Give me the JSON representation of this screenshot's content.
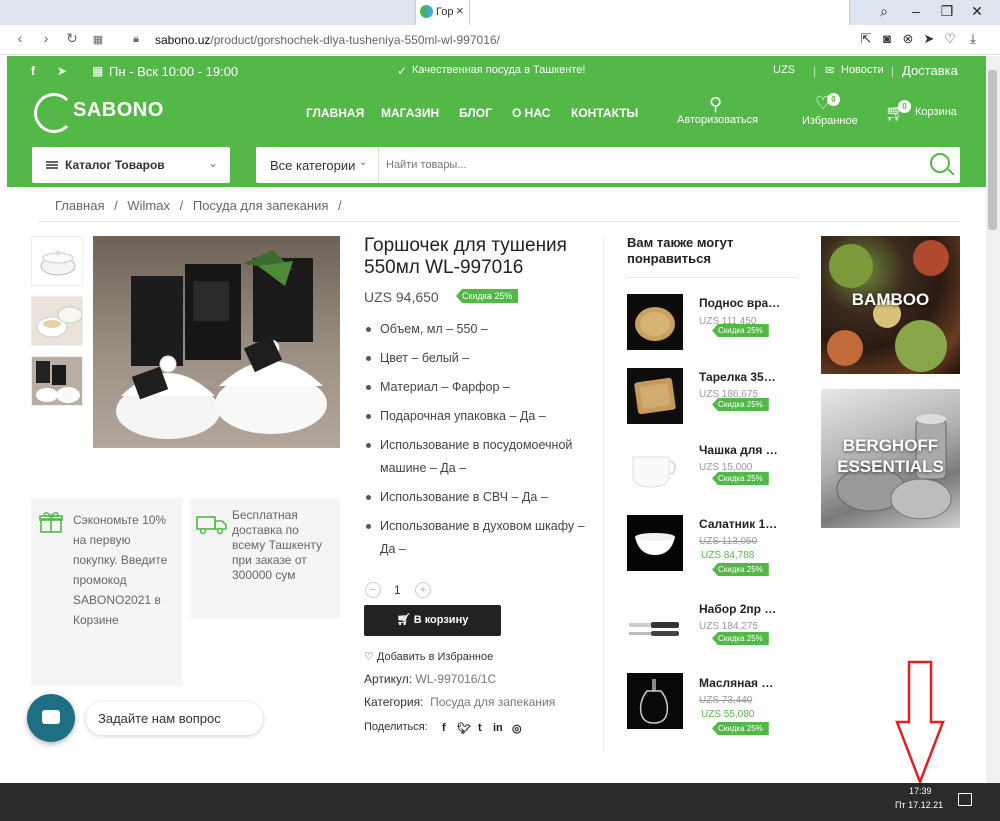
{
  "browser": {
    "tab_title": "Гор",
    "tab_close": "×",
    "url_host": "sabono.uz",
    "url_path": "/product/gorshochek-dlya-tusheniya-550ml-wl-997016/"
  },
  "topstrip": {
    "hours": "Пн - Вск 10:00 - 19:00",
    "slogan": "Качественная посуда в Ташкенте!",
    "currency": "UZS",
    "news": "Новости",
    "delivery": "Доставка"
  },
  "header": {
    "logo": "SABONO",
    "nav": [
      "ГЛАВНАЯ",
      "МАГАЗИН",
      "БЛОГ",
      "О НАС",
      "КОНТАКТЫ"
    ],
    "login": "Авторизоваться",
    "wishlist": "Избранное",
    "wishlist_count": "0",
    "cart": "Корзина",
    "cart_count": "0"
  },
  "search": {
    "catalog_label": "Каталог Товаров",
    "category": "Все категории",
    "placeholder": "Найти товары..."
  },
  "breadcrumb": [
    "Главная",
    "/",
    "Wilmax",
    "/",
    "Посуда для запекания",
    "/"
  ],
  "product": {
    "title": "Горшочек для тушения 550мл WL-997016",
    "price": "UZS 94,650",
    "discount": "Скидка 25%",
    "specs": [
      "Объем, мл – 550 –",
      "Цвет – белый –",
      "Материал – Фарфор –",
      "Подарочная упаковка – Да –",
      "Использование в посудомоечной машине – Да –",
      "Использование в СВЧ – Да –",
      "Использование в духовом шкафу – Да –"
    ],
    "qty_minus": "−",
    "qty": "1",
    "qty_plus": "+",
    "add_to_cart": "В корзину",
    "add_to_wishlist": "Добавить в Избранное",
    "sku_label": "Артикул:",
    "sku": "WL-997016/1C",
    "category_label": "Категория:",
    "category": "Посуда для запекания",
    "share_label": "Поделиться:",
    "share_icons": [
      "f",
      "t-bird",
      "t",
      "in",
      "whatsapp"
    ]
  },
  "info_boxes": {
    "gift": "Сэкономьте 10% на первую покупку. Введите промокод SABONO2021 в Корзине",
    "delivery": "Бесплатная доставка по всему Ташкенту при заказе от 300000 сум"
  },
  "recommended": {
    "title": "Вам также могут понравиться",
    "items": [
      {
        "name": "Поднос вра…",
        "old": "",
        "price": "UZS 111,450",
        "discount": "Скидка 25%"
      },
      {
        "name": "Тарелка 35…",
        "old": "",
        "price": "UZS 186,675",
        "discount": "Скидка 25%"
      },
      {
        "name": "Чашка для …",
        "old": "",
        "price": "UZS 15,000",
        "discount": "Скидка 25%"
      },
      {
        "name": "Салатник 1…",
        "old": "UZS 113,050",
        "price": "UZS 84,788",
        "discount": "Скидка 25%"
      },
      {
        "name": "Набор 2пр …",
        "old": "",
        "price": "UZS 184,275",
        "discount": "Скидка 25%"
      },
      {
        "name": "Масляная …",
        "old": "UZS 73,440",
        "price": "UZS 55,080",
        "discount": "Скидка 25%"
      }
    ]
  },
  "banners": {
    "bamboo": "BAMBOO",
    "berghoff": "BERGHOFF ESSENTIALS"
  },
  "chat": {
    "prompt": "Задайте нам вопрос"
  },
  "taskbar": {
    "time": "17:39",
    "date": "Пт 17.12.21"
  },
  "colors": {
    "brand_green": "#54b848",
    "annotation_red": "#e02020"
  }
}
